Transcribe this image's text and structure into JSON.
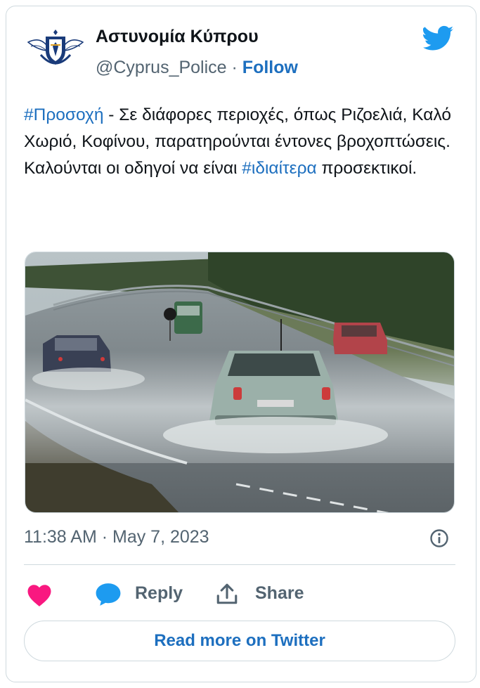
{
  "author": {
    "name": "Αστυνομία Κύπρου",
    "handle": "@Cyprus_Police",
    "separator": "·",
    "follow_label": "Follow"
  },
  "tweet": {
    "hashtag1": "#Προσοχή",
    "line1_rest": " - Σε διάφορες περιοχές, όπως Ριζοελιά, Καλό Χωριό, Κοφίνου, παρατηρούνται έντονες βροχοπτώσεις.",
    "line2_pre": "Καλούνται οι οδηγοί να είναι ",
    "hashtag2": "#ιδιαίτερα",
    "line2_post": " προσεκτικοί."
  },
  "timestamp": "11:38 AM · May 7, 2023",
  "actions": {
    "reply_label": "Reply",
    "share_label": "Share"
  },
  "read_more_label": "Read more on Twitter",
  "icons": {
    "brand": "twitter-bird-icon",
    "like": "heart-icon",
    "reply": "reply-bubble-icon",
    "share": "share-icon",
    "info": "info-icon"
  },
  "colors": {
    "link": "#1d6fbf",
    "twitter_blue": "#1d9bf0",
    "heart": "#f91880",
    "muted": "#536471",
    "border": "#cfd9de"
  }
}
